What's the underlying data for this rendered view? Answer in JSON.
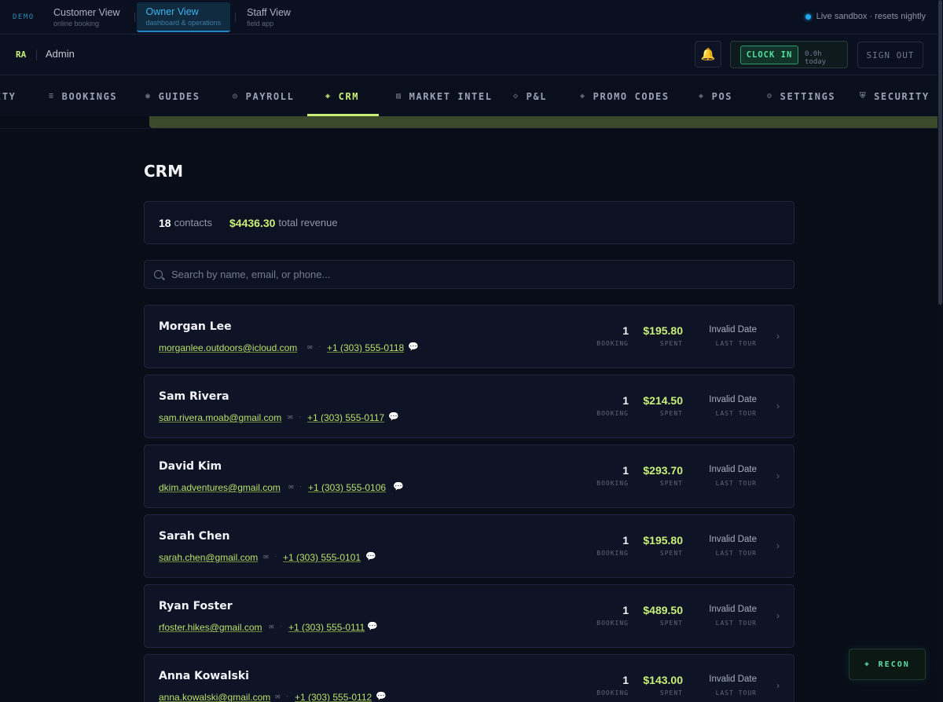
{
  "demo_bar": {
    "label": "DEMO",
    "views": [
      {
        "title": "Customer View",
        "subtitle": "online booking"
      },
      {
        "title": "Owner View",
        "subtitle": "dashboard & operations"
      },
      {
        "title": "Staff View",
        "subtitle": "field app"
      }
    ],
    "sandbox_status": "Live sandbox · resets nightly"
  },
  "header": {
    "initials": "RA",
    "role": "Admin",
    "bell_icon": "🔔",
    "clock_in_label": "CLOCK IN",
    "hours_today": "0.0h today",
    "sign_out_label": "SIGN OUT"
  },
  "nav": {
    "items": [
      {
        "label": "ITY",
        "icon": ""
      },
      {
        "label": "BOOKINGS",
        "icon": "≡"
      },
      {
        "label": "GUIDES",
        "icon": "◉"
      },
      {
        "label": "PAYROLL",
        "icon": "◎"
      },
      {
        "label": "CRM",
        "icon": "◈"
      },
      {
        "label": "MARKET INTEL",
        "icon": "▨"
      },
      {
        "label": "P&L",
        "icon": "◇"
      },
      {
        "label": "PROMO CODES",
        "icon": "◈"
      },
      {
        "label": "POS",
        "icon": "◈"
      },
      {
        "label": "SETTINGS",
        "icon": "⚙"
      },
      {
        "label": "SECURITY",
        "icon": "⛨"
      }
    ],
    "active": "CRM"
  },
  "page": {
    "title": "CRM",
    "contacts_count": "18",
    "contacts_label": "contacts",
    "total_revenue": "$4436.30",
    "revenue_label": "total revenue",
    "search_placeholder": "Search by name, email, or phone..."
  },
  "contacts": [
    {
      "name": "Morgan Lee",
      "email": "morganlee.outdoors@icloud.com",
      "phone": "+1 (303) 555-0118",
      "bookings": "1",
      "bookings_label": "BOOKING",
      "spent": "$195.80",
      "spent_label": "SPENT",
      "last_tour": "Invalid Date",
      "last_tour_label": "LAST TOUR"
    },
    {
      "name": "Sam Rivera",
      "email": "sam.rivera.moab@gmail.com",
      "phone": "+1 (303) 555-0117",
      "bookings": "1",
      "bookings_label": "BOOKING",
      "spent": "$214.50",
      "spent_label": "SPENT",
      "last_tour": "Invalid Date",
      "last_tour_label": "LAST TOUR"
    },
    {
      "name": "David Kim",
      "email": "dkim.adventures@gmail.com",
      "phone": "+1 (303) 555-0106",
      "bookings": "1",
      "bookings_label": "BOOKING",
      "spent": "$293.70",
      "spent_label": "SPENT",
      "last_tour": "Invalid Date",
      "last_tour_label": "LAST TOUR"
    },
    {
      "name": "Sarah Chen",
      "email": "sarah.chen@gmail.com",
      "phone": "+1 (303) 555-0101",
      "bookings": "1",
      "bookings_label": "BOOKING",
      "spent": "$195.80",
      "spent_label": "SPENT",
      "last_tour": "Invalid Date",
      "last_tour_label": "LAST TOUR"
    },
    {
      "name": "Ryan Foster",
      "email": "rfoster.hikes@gmail.com",
      "phone": "+1 (303) 555-0111",
      "bookings": "1",
      "bookings_label": "BOOKING",
      "spent": "$489.50",
      "spent_label": "SPENT",
      "last_tour": "Invalid Date",
      "last_tour_label": "LAST TOUR"
    },
    {
      "name": "Anna Kowalski",
      "email": "anna.kowalski@gmail.com",
      "phone": "+1 (303) 555-0112",
      "bookings": "1",
      "bookings_label": "BOOKING",
      "spent": "$143.00",
      "spent_label": "SPENT",
      "last_tour": "Invalid Date",
      "last_tour_label": "LAST TOUR"
    }
  ],
  "recon": {
    "label": "RECON",
    "icon": "◈"
  },
  "colors": {
    "accent": "#c8ef78",
    "link": "#b8e06a",
    "owner_view": "#3cb4f0",
    "clock_in": "#4fe0a0",
    "background": "#090d18"
  }
}
